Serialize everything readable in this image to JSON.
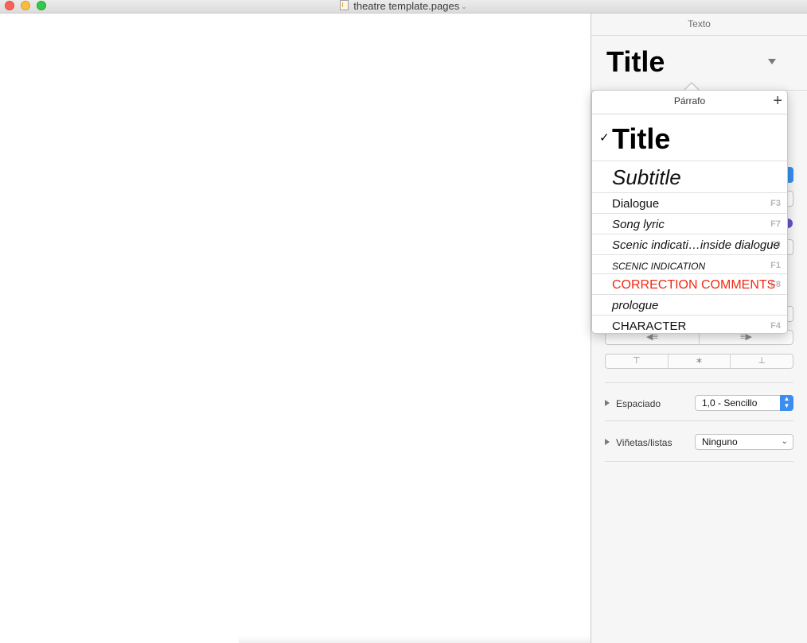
{
  "window": {
    "document_title": "theatre template.pages"
  },
  "inspector": {
    "header": "Texto",
    "current_style": "Title",
    "spacing": {
      "label": "Espaciado",
      "value": "1,0 - Sencillo"
    },
    "bullets": {
      "label": "Viñetas/listas",
      "value": "Ninguno"
    }
  },
  "popup": {
    "title": "Párrafo",
    "add_symbol": "+",
    "check_symbol": "✓",
    "styles": [
      {
        "name": "Title",
        "shortcut": "",
        "selected": true
      },
      {
        "name": "Subtitle",
        "shortcut": ""
      },
      {
        "name": "Dialogue",
        "shortcut": "F3"
      },
      {
        "name": "Song lyric",
        "shortcut": "F7"
      },
      {
        "name": "Scenic indicati…inside dialogue",
        "shortcut": "F2"
      },
      {
        "name": "SCENIC INDICATION",
        "shortcut": "F1"
      },
      {
        "name": "CORRECTION COMMENTS",
        "shortcut": "F8"
      },
      {
        "name": "prologue",
        "shortcut": ""
      },
      {
        "name": "CHARACTER",
        "shortcut": "F4"
      }
    ]
  },
  "colors": {
    "accent": "#3b8df0",
    "correction": "#ef2a13"
  }
}
